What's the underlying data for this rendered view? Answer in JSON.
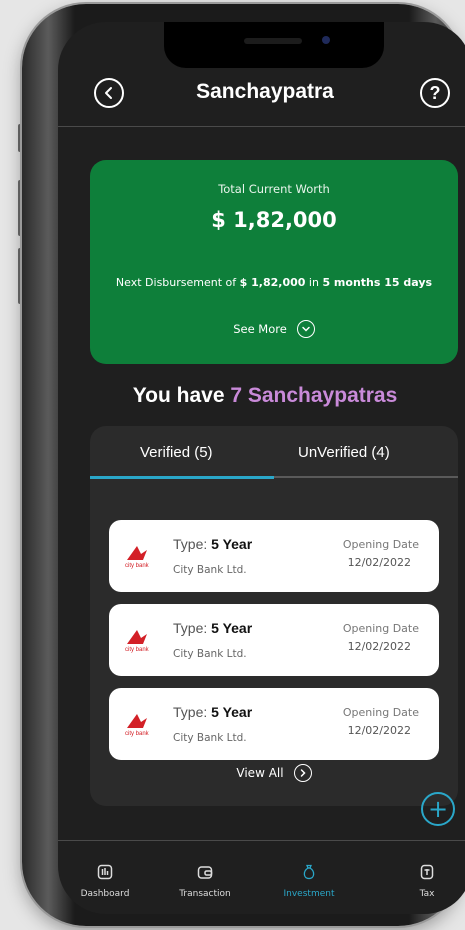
{
  "header": {
    "title": "Sanchaypatra",
    "back_icon": "back-arrow-icon",
    "help_label": "?"
  },
  "worth_card": {
    "label": "Total Current Worth",
    "amount": "$ 1,82,000",
    "next_prefix": "Next Disbursement of ",
    "next_amount": "$ 1,82,000",
    "next_mid": " in ",
    "next_time": "5 months 15 days",
    "see_more": "See More",
    "bg_color": "#0e7f3a"
  },
  "summary": {
    "prefix": "You have ",
    "highlight": "7 Sanchaypatras",
    "highlight_color": "#c98ad9"
  },
  "tabs": [
    {
      "label": "Verified (5)",
      "active": true
    },
    {
      "label": "UnVerified (4)",
      "active": false
    }
  ],
  "items": [
    {
      "type_label": "Type: ",
      "type_value": "5 Year",
      "bank": "City Bank Ltd.",
      "date_label": "Opening Date",
      "date": "12/02/2022",
      "logo_text": "city bank"
    },
    {
      "type_label": "Type: ",
      "type_value": "5 Year",
      "bank": "City Bank Ltd.",
      "date_label": "Opening Date",
      "date": "12/02/2022",
      "logo_text": "city bank"
    },
    {
      "type_label": "Type: ",
      "type_value": "5 Year",
      "bank": "City Bank Ltd.",
      "date_label": "Opening Date",
      "date": "12/02/2022",
      "logo_text": "city bank"
    }
  ],
  "view_all": "View All",
  "fab": {
    "label": "+",
    "icon": "add-icon"
  },
  "bottom_nav": [
    {
      "label": "Dashboard",
      "icon": "dashboard-icon",
      "active": false
    },
    {
      "label": "Transaction",
      "icon": "wallet-icon",
      "active": false
    },
    {
      "label": "Investment",
      "icon": "money-bag-icon",
      "active": true
    },
    {
      "label": "Tax",
      "icon": "tax-document-icon",
      "active": false
    }
  ],
  "accent_color": "#2aa7c9"
}
